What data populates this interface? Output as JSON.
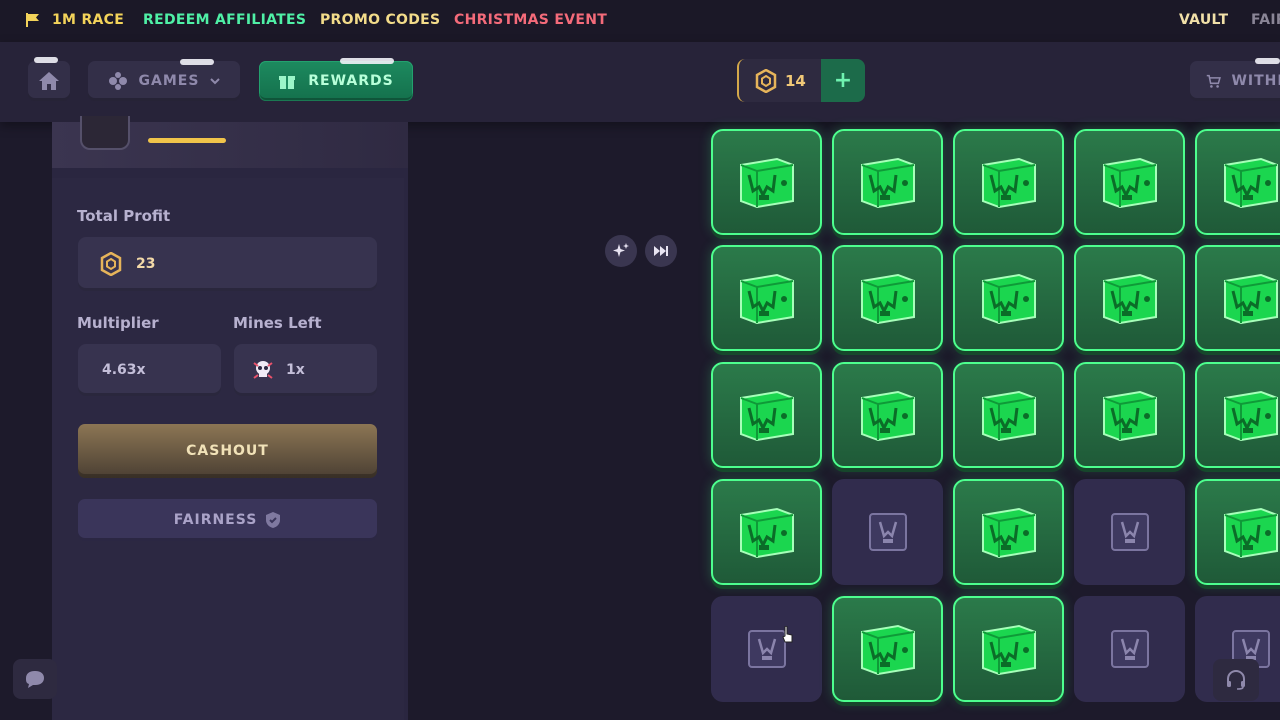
{
  "topbar": {
    "links": {
      "race": "1M RACE",
      "affiliates": "REDEEM AFFILIATES",
      "promo": "PROMO CODES",
      "christmas": "CHRISTMAS EVENT",
      "vault": "VAULT",
      "fair": "FAIR"
    }
  },
  "nav": {
    "games_label": "GAMES",
    "rewards_label": "REWARDS",
    "balance": "14",
    "withdraw_label": "WITHD"
  },
  "panel": {
    "total_profit_label": "Total Profit",
    "total_profit_value": "23",
    "multiplier_label": "Multiplier",
    "multiplier_value": "4.63x",
    "mines_left_label": "Mines Left",
    "mines_left_value": "1x",
    "cashout_label": "CASHOUT",
    "fairness_label": "FAIRNESS"
  },
  "grid": {
    "rows": [
      [
        "gem",
        "gem",
        "gem",
        "gem",
        "gem"
      ],
      [
        "gem",
        "gem",
        "gem",
        "gem",
        "gem"
      ],
      [
        "gem",
        "gem",
        "gem",
        "gem",
        "gem"
      ],
      [
        "gem",
        "empty",
        "gem",
        "empty",
        "gem"
      ],
      [
        "empty",
        "gem",
        "gem",
        "empty",
        "empty"
      ]
    ]
  },
  "colors": {
    "race": "#f3d35a",
    "affiliates": "#4ff0a6",
    "promo": "#f3dc8a",
    "christmas": "#f46b7a",
    "vault": "#f1e0a8",
    "fair": "#8a8596"
  },
  "icons": [
    "flag-icon",
    "home-icon",
    "gamepad-icon",
    "chevron-down-icon",
    "gift-icon",
    "coin-icon",
    "plus-icon",
    "cart-icon",
    "sparkle-icon",
    "skip-icon",
    "skull-icon",
    "shield-icon",
    "chat-icon",
    "headset-icon",
    "gem-box-icon",
    "empty-box-icon"
  ]
}
